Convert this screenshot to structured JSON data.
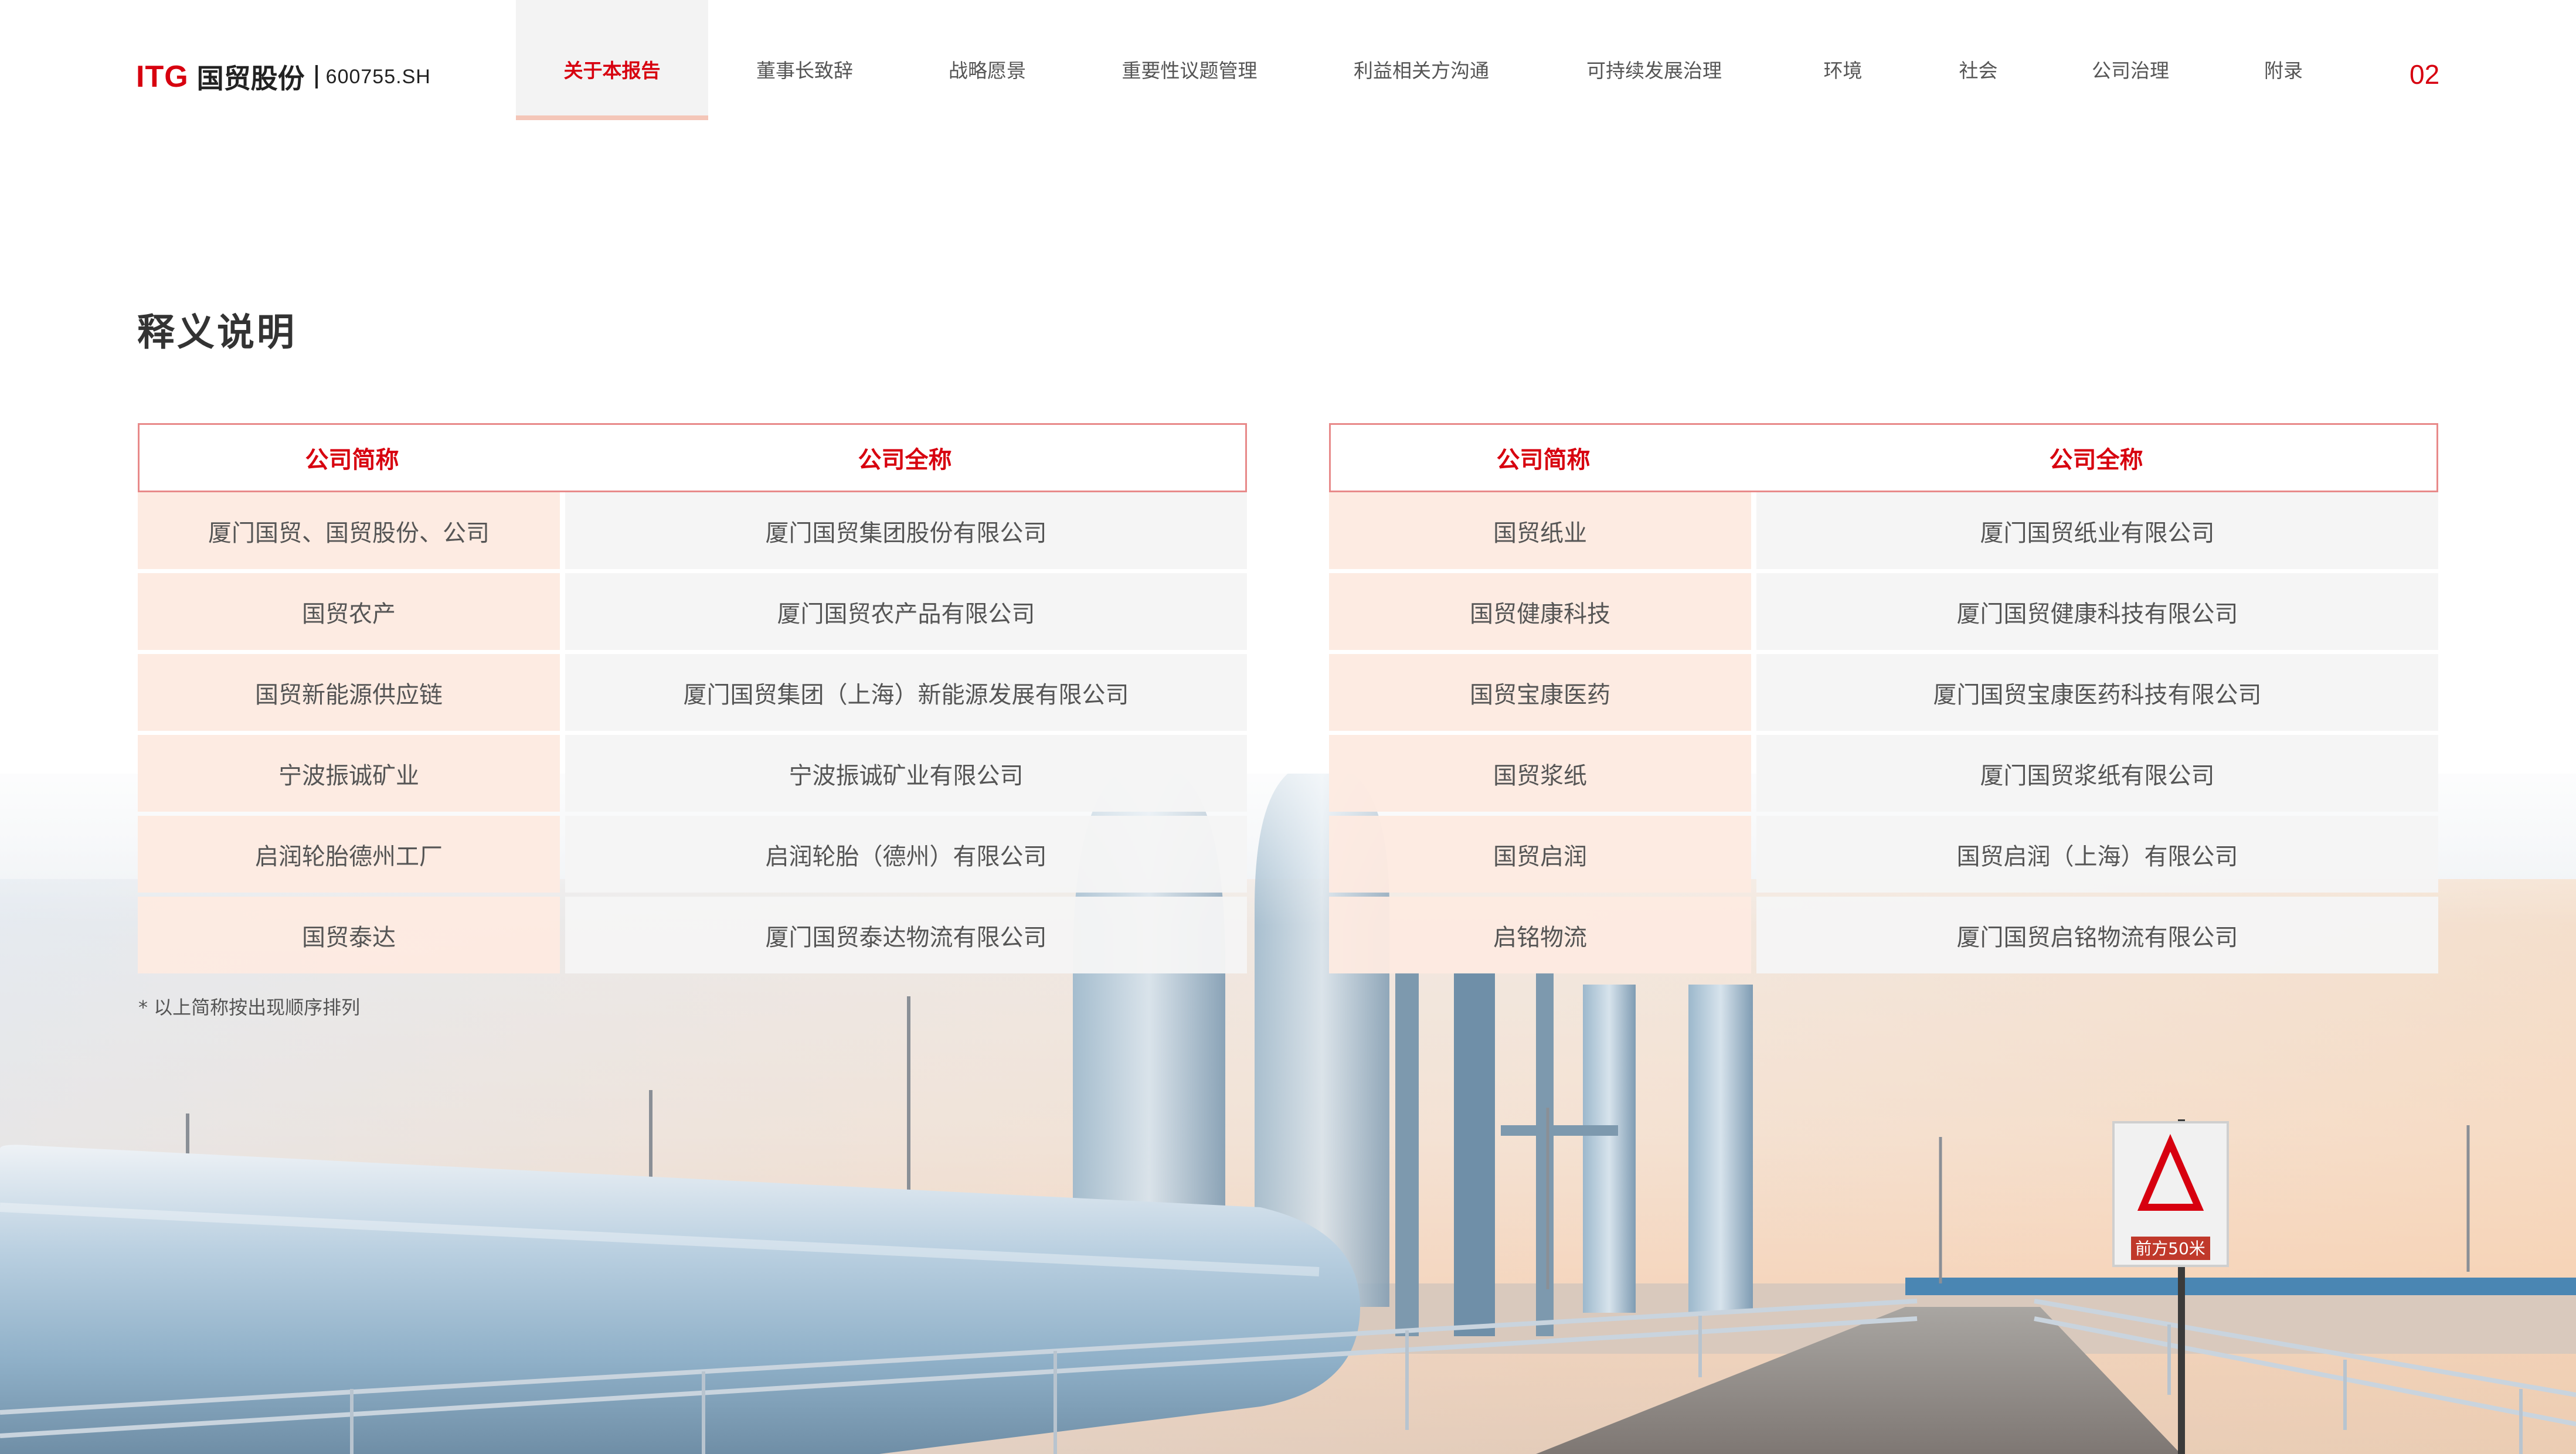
{
  "header": {
    "logo_itg": "ITG",
    "logo_cn": "国贸股份",
    "stock_code": "600755.SH",
    "nav": [
      {
        "label": "关于本报告",
        "active": true
      },
      {
        "label": "董事长致辞",
        "active": false
      },
      {
        "label": "战略愿景",
        "active": false
      },
      {
        "label": "重要性议题管理",
        "active": false
      },
      {
        "label": "利益相关方沟通",
        "active": false
      },
      {
        "label": "可持续发展治理",
        "active": false
      },
      {
        "label": "环境",
        "active": false
      },
      {
        "label": "社会",
        "active": false
      },
      {
        "label": "公司治理",
        "active": false
      },
      {
        "label": "附录",
        "active": false
      }
    ],
    "page_number": "02"
  },
  "main": {
    "title": "释义说明",
    "left_table": {
      "headers": [
        "公司简称",
        "公司全称"
      ],
      "rows": [
        [
          "厦门国贸、国贸股份、公司",
          "厦门国贸集团股份有限公司"
        ],
        [
          "国贸农产",
          "厦门国贸农产品有限公司"
        ],
        [
          "国贸新能源供应链",
          "厦门国贸集团（上海）新能源发展有限公司"
        ],
        [
          "宁波振诚矿业",
          "宁波振诚矿业有限公司"
        ],
        [
          "启润轮胎德州工厂",
          "启润轮胎（德州）有限公司"
        ],
        [
          "国贸泰达",
          "厦门国贸泰达物流有限公司"
        ]
      ]
    },
    "right_table": {
      "headers": [
        "公司简称",
        "公司全称"
      ],
      "rows": [
        [
          "国贸纸业",
          "厦门国贸纸业有限公司"
        ],
        [
          "国贸健康科技",
          "厦门国贸健康科技有限公司"
        ],
        [
          "国贸宝康医药",
          "厦门国贸宝康医药科技有限公司"
        ],
        [
          "国贸浆纸",
          "厦门国贸浆纸有限公司"
        ],
        [
          "国贸启润",
          "国贸启润（上海）有限公司"
        ],
        [
          "启铭物流",
          "厦门国贸启铭物流有限公司"
        ]
      ]
    },
    "footnote": "* 以上简称按出现顺序排列"
  },
  "background": {
    "sign_text": "前方50米"
  },
  "colors": {
    "accent": "#d7000f",
    "header_border": "#e88a8a",
    "short_name_bg": "#fdeae1",
    "full_name_bg": "#f5f5f5"
  }
}
